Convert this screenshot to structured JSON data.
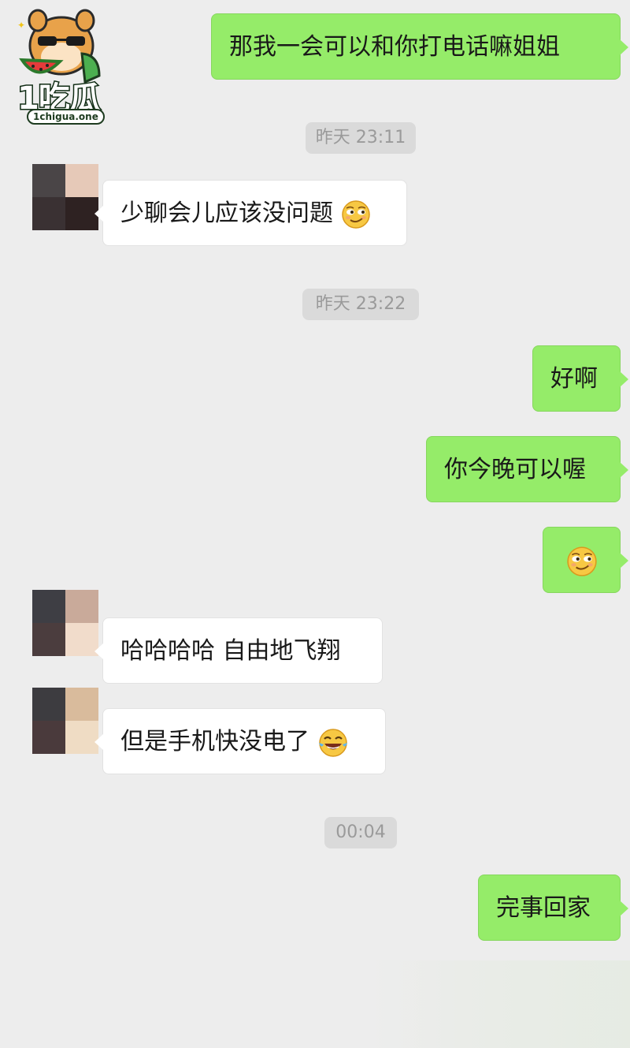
{
  "colors": {
    "background": "#ededed",
    "bubble_me": "#95ec69",
    "bubble_them": "#ffffff",
    "timestamp_bg": "#dadada",
    "timestamp_text": "#9a9a9a"
  },
  "watermark": {
    "title": "1吃瓜",
    "domain": "1chigua.one"
  },
  "chat": {
    "msg1": {
      "text": "那我一会可以和你打电话嘛姐姐"
    },
    "ts1": "昨天 23:11",
    "msg2": {
      "text": "少聊会儿应该没问题",
      "emoji": "smirk-face"
    },
    "ts2": "昨天 23:22",
    "msg3": {
      "text": "好啊"
    },
    "msg4": {
      "text": "你今晚可以喔"
    },
    "msg5": {
      "emoji": "smirk-face"
    },
    "msg6": {
      "text": "哈哈哈哈 自由地飞翔"
    },
    "msg7": {
      "text": "但是手机快没电了",
      "emoji": "tears-of-joy-face"
    },
    "ts3": "00:04",
    "msg8": {
      "text": "完事回家"
    }
  }
}
